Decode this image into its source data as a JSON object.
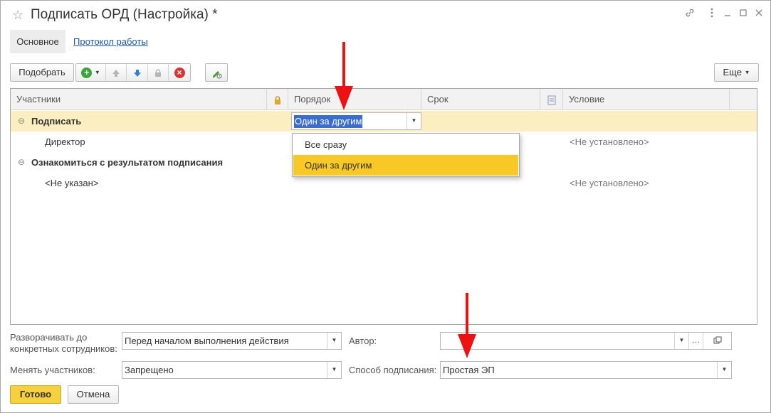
{
  "window": {
    "title": "Подписать ОРД (Настройка) *",
    "icons": [
      "star-icon",
      "link-icon",
      "more-icon",
      "minimize-icon",
      "maximize-icon",
      "close-icon"
    ]
  },
  "tabs": [
    {
      "label": "Основное",
      "active": true
    },
    {
      "label": "Протокол работы",
      "active": false
    }
  ],
  "toolbar": {
    "pick_label": "Подобрать",
    "more_label": "Еще",
    "icons": [
      "add-icon",
      "move-up-icon",
      "move-down-icon",
      "lock-icon",
      "delete-icon",
      "edit-icon"
    ]
  },
  "grid": {
    "columns": [
      "Участники",
      "Порядок",
      "Срок",
      "Условие"
    ],
    "rows": [
      {
        "participant": "Подписать",
        "order": "Один за другим",
        "condition": ""
      },
      {
        "participant": "Директор",
        "condition": "<Не установлено>"
      },
      {
        "participant": "Ознакомиться с результатом подписания",
        "condition": ""
      },
      {
        "participant": "<Не указан>",
        "condition": "<Не установлено>"
      }
    ]
  },
  "dropdown": {
    "options": [
      "Все сразу",
      "Один за другим"
    ],
    "selected": "Один за другим"
  },
  "form": {
    "expand_label": "Разворачивать до\nконкретных сотрудников:",
    "expand_value": "Перед началом выполнения действия",
    "author_label": "Автор:",
    "author_value": "",
    "change_label": "Менять участников:",
    "change_value": "Запрещено",
    "sign_method_label": "Способ подписания:",
    "sign_method_value": "Простая ЭП"
  },
  "buttons": {
    "done": "Готово",
    "cancel": "Отмена"
  },
  "colors": {
    "accent_yellow": "#f7c826",
    "row_selected": "#fbeec0",
    "link_blue": "#1c55a4",
    "arrow_red": "#ee1111"
  }
}
